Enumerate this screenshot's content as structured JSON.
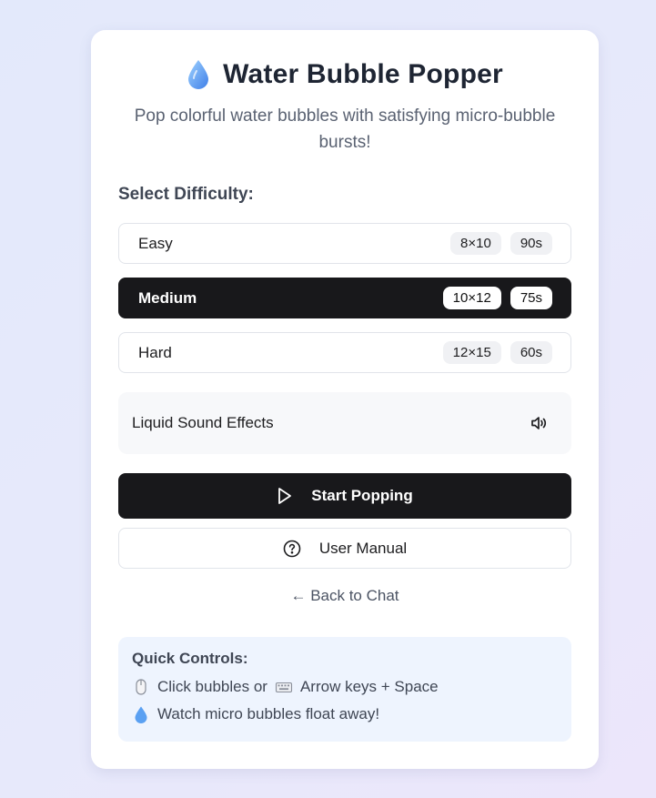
{
  "header": {
    "icon": "water-drop-icon",
    "title": "Water Bubble Popper",
    "subtitle": "Pop colorful water bubbles with satisfying micro-bubble bursts!"
  },
  "difficulty": {
    "label": "Select Difficulty:",
    "selected": "Medium",
    "options": [
      {
        "name": "Easy",
        "grid": "8×10",
        "time": "90s"
      },
      {
        "name": "Medium",
        "grid": "10×12",
        "time": "75s"
      },
      {
        "name": "Hard",
        "grid": "12×15",
        "time": "60s"
      }
    ]
  },
  "sound": {
    "label": "Liquid Sound Effects",
    "icon": "speaker-icon",
    "enabled": true
  },
  "actions": {
    "start_label": "Start Popping",
    "start_icon": "play-icon",
    "manual_label": "User Manual",
    "manual_icon": "help-circle-icon",
    "back_label": "← Back to Chat"
  },
  "quick_controls": {
    "heading": "Quick Controls:",
    "line1_a": "Click bubbles or",
    "line1_b": "Arrow keys + Space",
    "line2": "Watch micro bubbles float away!",
    "icons": [
      "mouse-icon",
      "keyboard-icon",
      "water-drop-icon"
    ]
  },
  "colors": {
    "primary": "#18181b",
    "background": "#e6e9fb",
    "controls_bg": "#eef4fe"
  }
}
